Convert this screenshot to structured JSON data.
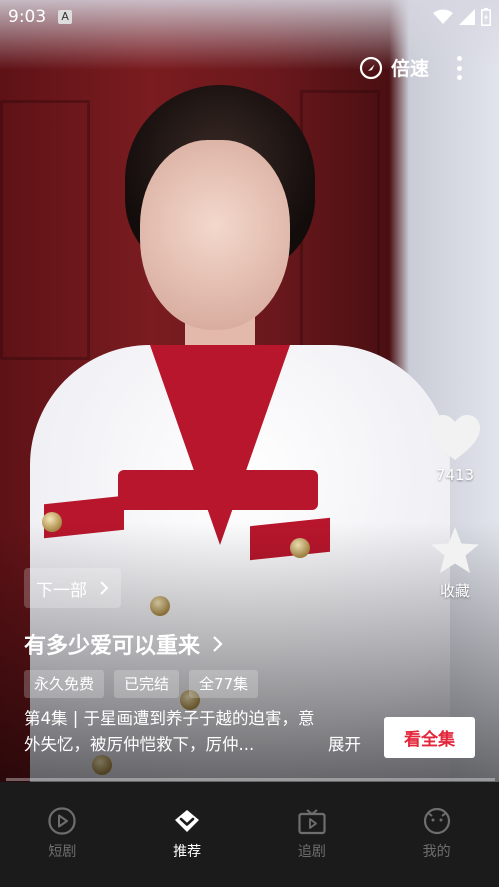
{
  "status_bar": {
    "time": "9:03",
    "indicator": "A"
  },
  "top_controls": {
    "speed_label": "倍速"
  },
  "side_actions": {
    "like_count": "7413",
    "collect_label": "收藏"
  },
  "info": {
    "next_label": "下一部",
    "title": "有多少爱可以重来",
    "tags": [
      "永久免费",
      "已完结",
      "全77集"
    ],
    "description_line1": "第4集 | 于星画遭到养子于越的迫害，意",
    "description_line2": "外失忆，被厉仲恺救下，厉仲...",
    "expand_label": "展开",
    "watch_all_label": "看全集"
  },
  "playback": {
    "progress": 0.0
  },
  "bottom_nav": {
    "items": [
      {
        "label": "短剧",
        "icon": "play-circle-icon",
        "active": false
      },
      {
        "label": "推荐",
        "icon": "diamond-icon",
        "active": true
      },
      {
        "label": "追剧",
        "icon": "tv-icon",
        "active": false
      },
      {
        "label": "我的",
        "icon": "face-icon",
        "active": false
      }
    ]
  },
  "colors": {
    "accent_red": "#e4263a",
    "nav_bg": "#1b1b1b",
    "nav_inactive": "#6e6e6e"
  }
}
